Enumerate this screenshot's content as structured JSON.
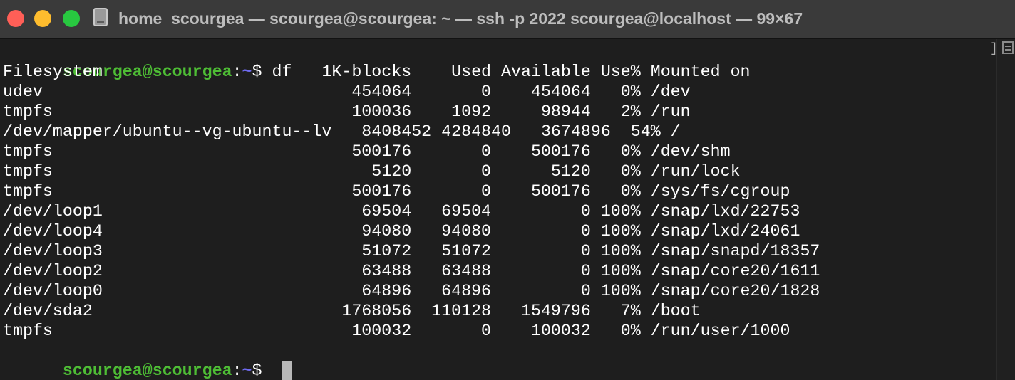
{
  "window": {
    "title": "home_scourgea — scourgea@scourgea: ~ — ssh -p 2022 scourgea@localhost — 99×67",
    "traffic_lights": {
      "close": "#ff5f57",
      "minimize": "#febc2e",
      "zoom": "#28c840"
    }
  },
  "terminal": {
    "prompt": {
      "user_host": "scourgea@scourgea",
      "colon": ":",
      "path": "~",
      "dollar": "$ "
    },
    "command": "df",
    "output_lines": [
      "Filesystem                      1K-blocks    Used Available Use% Mounted on",
      "udev                               454064       0    454064   0% /dev",
      "tmpfs                              100036    1092     98944   2% /run",
      "/dev/mapper/ubuntu--vg-ubuntu--lv   8408452 4284840   3674896  54% /",
      "tmpfs                              500176       0    500176   0% /dev/shm",
      "tmpfs                                5120       0      5120   0% /run/lock",
      "tmpfs                              500176       0    500176   0% /sys/fs/cgroup",
      "/dev/loop1                          69504   69504         0 100% /snap/lxd/22753",
      "/dev/loop4                          94080   94080         0 100% /snap/lxd/24061",
      "/dev/loop3                          51072   51072         0 100% /snap/snapd/18357",
      "/dev/loop2                          63488   63488         0 100% /snap/core20/1611",
      "/dev/loop0                          64896   64896         0 100% /snap/core20/1828",
      "/dev/sda2                         1768056  110128   1549796   7% /boot",
      "tmpfs                              100032       0    100032   0% /run/user/1000"
    ],
    "scroll_marker": "]",
    "colors": {
      "user_host": "#4ebd35",
      "path": "#6f6bf0",
      "background": "#1e1e1e",
      "text": "#ffffff"
    }
  }
}
